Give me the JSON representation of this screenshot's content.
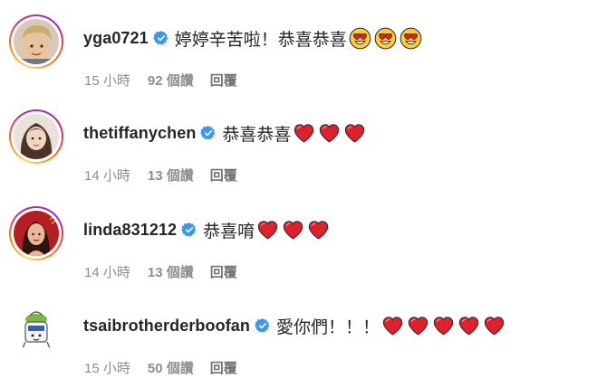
{
  "comments": [
    {
      "username": "yga0721",
      "text": "婷婷辛苦啦！恭喜恭喜",
      "emojis": [
        "heart-eyes",
        "heart-eyes",
        "heart-eyes"
      ],
      "time": "15 小時",
      "likes": "92 個讚",
      "reply": "回覆",
      "story_ring": true
    },
    {
      "username": "thetiffanychen",
      "text": "恭喜恭喜",
      "emojis": [
        "heart",
        "heart",
        "heart"
      ],
      "time": "14 小時",
      "likes": "13 個讚",
      "reply": "回覆",
      "story_ring": true
    },
    {
      "username": "linda831212",
      "text": "恭喜唷",
      "emojis": [
        "heart",
        "heart",
        "heart"
      ],
      "time": "14 小時",
      "likes": "13 個讚",
      "reply": "回覆",
      "story_ring": true
    },
    {
      "username": "tsaibrotherderboofan",
      "text": "愛你們！！！",
      "emojis": [
        "heart",
        "heart",
        "heart",
        "heart",
        "heart"
      ],
      "time": "15 小時",
      "likes": "50 個讚",
      "reply": "回覆",
      "story_ring": false
    }
  ],
  "colors": {
    "verified_badge": "#3897f0",
    "meta_text": "#8e8e8e",
    "heart": "#e0202d"
  }
}
